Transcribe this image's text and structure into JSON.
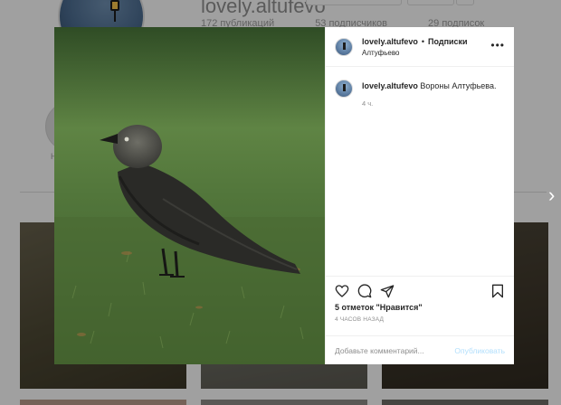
{
  "profile": {
    "username": "lovely.altufevo",
    "stats": {
      "posts": "172 публикаций",
      "followers": "53 подписчиков",
      "following": "29 подписок"
    },
    "story_label": "Н"
  },
  "post": {
    "header": {
      "username": "lovely.altufevo",
      "separator": "•",
      "follow_label": "Подписки",
      "location": "Алтуфьево",
      "more_icon": "more-horizontal-icon",
      "more_label": "•••"
    },
    "caption": {
      "username": "lovely.altufevo",
      "text": " Вороны Алтуфьева.",
      "time": "4 ч."
    },
    "actions": {
      "icons": [
        "heart-icon",
        "comment-icon",
        "share-icon",
        "bookmark-icon"
      ],
      "likes": "5 отметок \"Нравится\"",
      "timestamp": "4 ЧАСОВ НАЗАД"
    },
    "comment": {
      "placeholder": "Добавьте комментарий...",
      "publish_label": "Опубликовать"
    },
    "photo_subject": "jackdaw bird on grass"
  },
  "navigation": {
    "next_arrow": "chevron-right-icon",
    "next_label": "›"
  },
  "colors": {
    "link_disabled": "#b2dffc",
    "text": "#262626",
    "muted": "#8e8e8e",
    "grass": "#50723a"
  }
}
